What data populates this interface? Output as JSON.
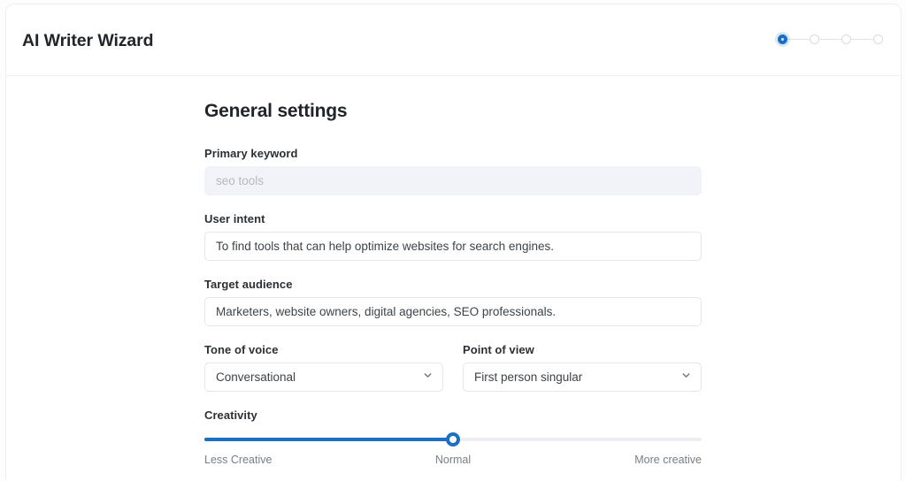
{
  "app": {
    "title": "AI Writer Wizard"
  },
  "stepper": {
    "active_index": 0,
    "total_steps": 4,
    "active_color": "#1a6fc4",
    "inactive_color": "#d8dce1"
  },
  "main": {
    "section_title": "General settings",
    "fields": {
      "primary_keyword": {
        "label": "Primary keyword",
        "value": "",
        "placeholder": "seo tools",
        "disabled": true
      },
      "user_intent": {
        "label": "User intent",
        "value": "To find tools that can help optimize websites for search engines.",
        "placeholder": ""
      },
      "target_audience": {
        "label": "Target audience",
        "value": "Marketers, website owners, digital agencies, SEO professionals.",
        "placeholder": ""
      },
      "tone_of_voice": {
        "label": "Tone of voice",
        "value": "Conversational",
        "icon": "chevron-down-icon"
      },
      "point_of_view": {
        "label": "Point of view",
        "value": "First person singular",
        "icon": "chevron-down-icon"
      },
      "creativity": {
        "label": "Creativity",
        "value_percent": 50,
        "min_label": "Less Creative",
        "mid_label": "Normal",
        "max_label": "More creative",
        "fill_color": "#1a6fc4"
      }
    }
  }
}
